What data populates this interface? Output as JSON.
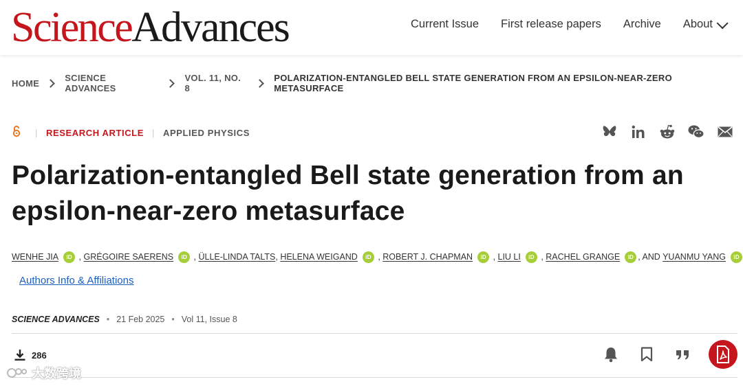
{
  "header": {
    "logo_science": "Science",
    "logo_advances": "Advances",
    "nav": [
      "Current Issue",
      "First release papers",
      "Archive",
      "About"
    ]
  },
  "breadcrumb": [
    "HOME",
    "SCIENCE ADVANCES",
    "VOL. 11, NO. 8",
    "POLARIZATION-ENTANGLED BELL STATE GENERATION FROM AN EPSILON-NEAR-ZERO METASURFACE"
  ],
  "article": {
    "type": "RESEARCH ARTICLE",
    "subject": "APPLIED PHYSICS",
    "title": "Polarization-entangled Bell state generation from an epsilon-near-zero metasurface",
    "authors": [
      "WENHE JIA",
      "GRÉGOIRE SAERENS",
      "ÜLLE-LINDA TALTS",
      "HELENA WEIGAND",
      "ROBERT J. CHAPMAN",
      "LIU LI",
      "RACHEL GRANGE",
      "YUANMU YANG"
    ],
    "orcid_label": "iD",
    "and_text": ", AND ",
    "affiliations_link": "Authors Info & Affiliations",
    "journal": "SCIENCE ADVANCES",
    "date": "21 Feb 2025",
    "volume_issue": "Vol 11, Issue 8",
    "downloads": "286"
  },
  "watermark": "大数跨境",
  "colors": {
    "brand_red": "#c4161c",
    "orcid_green": "#a6ce39",
    "link_blue": "#1d5fbf",
    "open_access_orange": "#e87722"
  },
  "icons": {
    "share": [
      "bluesky-icon",
      "linkedin-icon",
      "reddit-icon",
      "wechat-icon",
      "email-icon"
    ],
    "actions": [
      "bell-icon",
      "bookmark-icon",
      "quote-icon",
      "pdf-icon"
    ]
  }
}
